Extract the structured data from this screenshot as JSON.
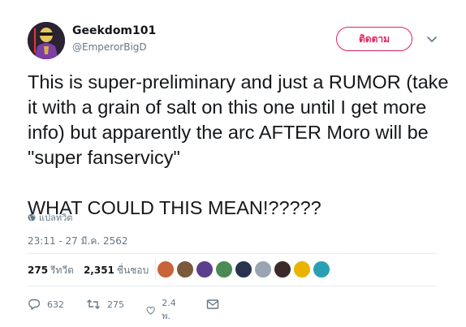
{
  "author": {
    "name": "Geekdom101",
    "handle": "@EmperorBigD"
  },
  "follow_button": {
    "label": "ติดตาม"
  },
  "tweet": {
    "text": "This is super-preliminary and just a RUMOR (take it with a grain of salt on this one until I get more info) but apparently the arc AFTER Moro will be \"super fanservicy\"\n\nWHAT COULD THIS MEAN!?????",
    "translate_label": "แปลทวิต",
    "timestamp": "23:11 - 27 มี.ค. 2562"
  },
  "stats": {
    "retweets_count": "275",
    "retweets_label": "รีทวีต",
    "likes_count": "2,351",
    "likes_label": "ชื่นชอบ"
  },
  "likers": [
    {
      "icon": "avatar-orange",
      "color": "#c8643a"
    },
    {
      "icon": "avatar-brown",
      "color": "#7a5a3a"
    },
    {
      "icon": "avatar-purple",
      "color": "#5b3f8c"
    },
    {
      "icon": "avatar-green",
      "color": "#4a8a55"
    },
    {
      "icon": "avatar-navy",
      "color": "#26344f"
    },
    {
      "icon": "avatar-default",
      "color": "#9aa5b1"
    },
    {
      "icon": "avatar-dark",
      "color": "#3a2a2a"
    },
    {
      "icon": "avatar-yellow",
      "color": "#e8b400"
    },
    {
      "icon": "avatar-teal",
      "color": "#2aa0b5"
    }
  ],
  "actions": {
    "replies": "632",
    "retweets": "275",
    "likes": "2.4 พ."
  },
  "colors": {
    "accent": "#e0245e",
    "secondary_text": "#657786"
  }
}
